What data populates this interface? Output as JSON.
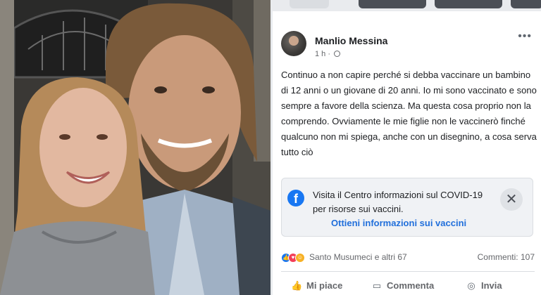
{
  "post": {
    "author": "Manlio Messina",
    "time": "1 h",
    "separator": "·",
    "text": "Continuo a non capire perché si debba vaccinare un bambino di 12 anni o un giovane di 20 anni. Io mi sono vaccinato e sono sempre a favore della scienza. Ma questa cosa proprio non la comprendo.  Ovviamente le mie figlie non le vaccinerò finché qualcuno non mi spiega,  anche con un disegnino, a cosa serva tutto ciò",
    "more_icon": "more-horizontal-icon",
    "privacy_icon": "globe-icon"
  },
  "covid_box": {
    "message": "Visita il Centro informazioni sul COVID-19 per risorse sui vaccini.",
    "link": "Ottieni informazioni sui vaccini",
    "icon": "facebook-logo-icon",
    "close_icon": "close-icon",
    "close_glyph": "✕"
  },
  "engagement": {
    "reactors": "Santo Musumeci e altri 67",
    "comments": "Commenti: 107",
    "reaction_icons": [
      "like-icon",
      "love-icon",
      "haha-icon"
    ]
  },
  "actions": {
    "like": "Mi piace",
    "comment": "Commenta",
    "share": "Invia"
  },
  "colors": {
    "facebook_blue": "#1877f2",
    "link_blue": "#216fdb",
    "text": "#1c1e21",
    "muted": "#65676b"
  }
}
